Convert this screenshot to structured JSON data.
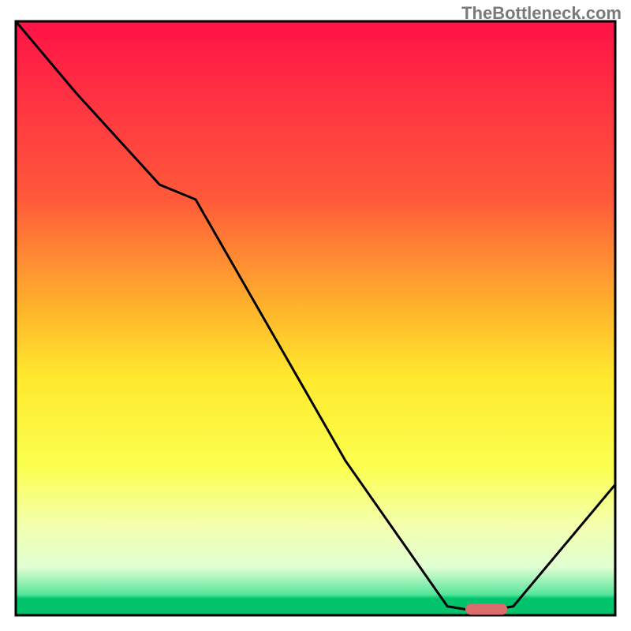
{
  "watermark": "TheBottleneck.com",
  "chart_data": {
    "type": "line",
    "title": "",
    "xlabel": "",
    "ylabel": "",
    "xlim": [
      0,
      100
    ],
    "ylim": [
      0,
      100
    ],
    "series": [
      {
        "name": "curve",
        "x": [
          0,
          10,
          24,
          30,
          55,
          72,
          75,
          80,
          83,
          100
        ],
        "y": [
          100,
          88,
          72.5,
          70,
          26,
          1.5,
          1,
          1,
          1.5,
          22
        ]
      }
    ],
    "marker": {
      "x_start": 75,
      "x_end": 82,
      "y": 1,
      "color": "#dd6b6e"
    },
    "gradient_stops": [
      {
        "offset": 0,
        "color": "#ff1347"
      },
      {
        "offset": 30,
        "color": "#ff5a3a"
      },
      {
        "offset": 48,
        "color": "#ffb22c"
      },
      {
        "offset": 60,
        "color": "#ffe92e"
      },
      {
        "offset": 75,
        "color": "#fbff4f"
      },
      {
        "offset": 85,
        "color": "#f3ffb0"
      },
      {
        "offset": 92,
        "color": "#dfffd2"
      },
      {
        "offset": 96.5,
        "color": "#57e59b"
      },
      {
        "offset": 97.2,
        "color": "#00c36c"
      },
      {
        "offset": 100,
        "color": "#00c36c"
      }
    ],
    "frame_color": "#000000",
    "line_color": "#000000"
  }
}
